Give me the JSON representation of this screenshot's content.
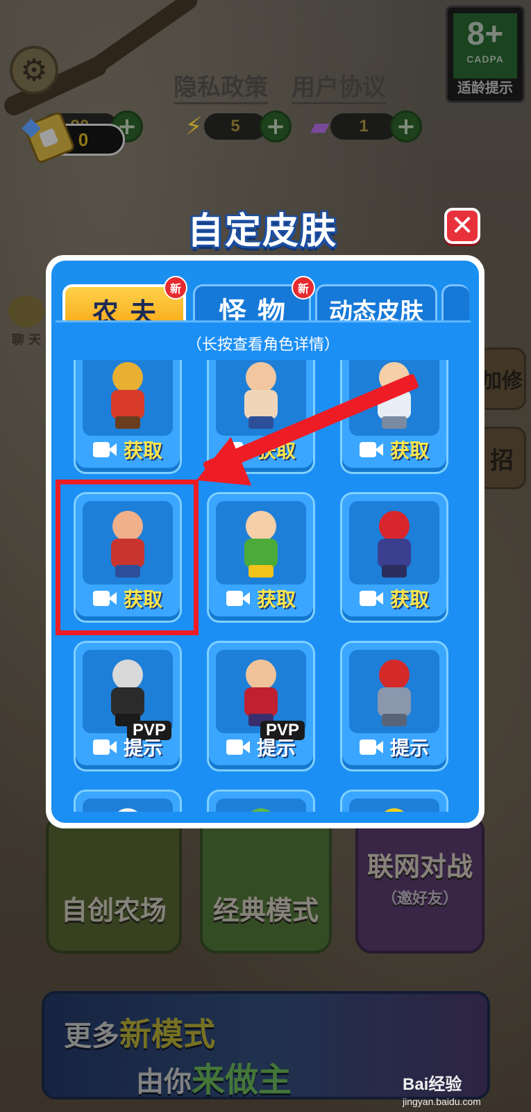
{
  "top_bar": {
    "policy_links": [
      "隐私政策",
      "用户协议"
    ],
    "age_rating": {
      "number": "8+",
      "org": "CADPA",
      "label": "适龄提示"
    },
    "resources": [
      {
        "name": "gem",
        "value": "90",
        "icon": "gem-icon"
      },
      {
        "name": "energy",
        "value": "5",
        "icon": "lightning-icon"
      },
      {
        "name": "ticket",
        "value": "1",
        "icon": "ticket-icon"
      }
    ],
    "coupon": {
      "value": "0",
      "icon": "coupon-icon"
    }
  },
  "side_menu": {
    "chat_label": "聊 天",
    "right_items": [
      "加修",
      "招"
    ]
  },
  "dialog": {
    "title": "自定皮肤",
    "close_icon": "close-icon",
    "tabs": [
      {
        "label": "农夫",
        "badge": "新",
        "active": true
      },
      {
        "label": "怪物",
        "badge": "新",
        "active": false
      },
      {
        "label": "动态皮肤",
        "badge": "",
        "active": false
      }
    ],
    "hint": "（长按查看角色详情）",
    "cards": [
      {
        "character": "leopard-farmer",
        "pvp": "",
        "action": "获取"
      },
      {
        "character": "bearded-butcher",
        "pvp": "",
        "action": "获取"
      },
      {
        "character": "glasses-boy",
        "pvp": "",
        "action": "获取"
      },
      {
        "character": "pig-farmer",
        "pvp": "",
        "action": "获取"
      },
      {
        "character": "green-shirt-man",
        "pvp": "",
        "action": "获取"
      },
      {
        "character": "gunner-soldier",
        "pvp": "",
        "action": "获取"
      },
      {
        "character": "dark-wizard",
        "pvp": "PVP",
        "action": "提示"
      },
      {
        "character": "caped-sorcerer",
        "pvp": "PVP",
        "action": "提示"
      },
      {
        "character": "red-robot",
        "pvp": "",
        "action": "提示"
      },
      {
        "character": "white-cat",
        "pvp": "",
        "action": ""
      },
      {
        "character": "green-goblin",
        "pvp": "",
        "action": ""
      },
      {
        "character": "yellow-ball",
        "pvp": "",
        "action": ""
      }
    ]
  },
  "modes": {
    "farm": "自创农场",
    "classic": "经典模式",
    "online": "联网对战",
    "online_sub": "（邀好友）"
  },
  "banner": {
    "line1_a": "更多",
    "line1_b": "新模式",
    "line2_a": "由你",
    "line2_b": "来做主"
  },
  "watermark": {
    "main": "Bai经验",
    "sub": "jingyan.baidu.com"
  },
  "colors": {
    "dialog_blue": "#1a8ff0",
    "tab_active": "#f7a412",
    "highlight_red": "#ee1c24",
    "get_yellow": "#ffe54a"
  }
}
